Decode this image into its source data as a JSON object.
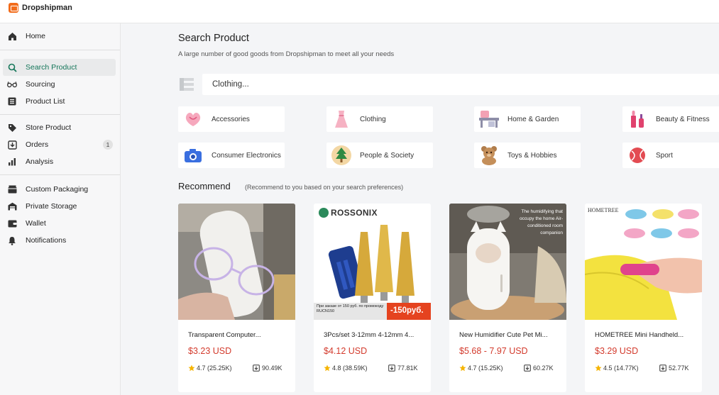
{
  "app": {
    "name": "Dropshipman"
  },
  "sidebar": {
    "groups": [
      [
        {
          "label": "Home",
          "icon": "home-icon"
        }
      ],
      [
        {
          "label": "Search Product",
          "icon": "search-icon",
          "active": true
        },
        {
          "label": "Sourcing",
          "icon": "glasses-icon"
        },
        {
          "label": "Product List",
          "icon": "list-icon"
        }
      ],
      [
        {
          "label": "Store Product",
          "icon": "tag-icon"
        },
        {
          "label": "Orders",
          "icon": "download-box-icon",
          "badge": "1"
        },
        {
          "label": "Analysis",
          "icon": "bar-chart-icon"
        }
      ],
      [
        {
          "label": "Custom Packaging",
          "icon": "package-icon"
        },
        {
          "label": "Private Storage",
          "icon": "warehouse-icon"
        },
        {
          "label": "Wallet",
          "icon": "wallet-icon"
        },
        {
          "label": "Notifications",
          "icon": "bell-icon"
        }
      ]
    ]
  },
  "main": {
    "title": "Search Product",
    "subtitle": "A large number of good goods from Dropshipman to meet all your needs",
    "search": {
      "value": "Clothing..."
    },
    "categories": [
      {
        "label": "Accessories",
        "icon": "accessories-icon"
      },
      {
        "label": "Clothing",
        "icon": "dress-icon"
      },
      {
        "label": "Home & Garden",
        "icon": "furniture-icon"
      },
      {
        "label": "Beauty & Fitness",
        "icon": "cosmetics-icon"
      },
      {
        "label": "Consumer Electronics",
        "icon": "camera-icon"
      },
      {
        "label": "People & Society",
        "icon": "tree-icon"
      },
      {
        "label": "Toys & Hobbies",
        "icon": "teddy-bear-icon"
      },
      {
        "label": "Sport",
        "icon": "ball-icon"
      }
    ],
    "recommend": {
      "title": "Recommend",
      "subtitle": "(Recommend to you based on your search preferences)"
    },
    "products": [
      {
        "name": "Transparent Computer...",
        "price": "$3.23 USD",
        "rating": "4.7 (25.25K)",
        "downloads": "90.49K",
        "image": "glasses-photo"
      },
      {
        "name": "3Pcs/set 3-12mm 4-12mm 4...",
        "price": "$4.12 USD",
        "rating": "4.8 (38.59K)",
        "downloads": "77.81K",
        "image": "drill-bits-photo",
        "brand": "ROSSONIX",
        "promo_text": "При заказе от 150 руб. по промокоду RUCN150",
        "promo_badge": "-150руб."
      },
      {
        "name": "New Humidifier Cute Pet Mi...",
        "price": "$5.68 - 7.97 USD",
        "rating": "4.7 (15.25K)",
        "downloads": "60.27K",
        "image": "humidifier-photo",
        "overlay_text": "The humidifying that occupy the home Air-conditioned room companion"
      },
      {
        "name": "HOMETREE Mini Handheld...",
        "price": "$3.29 USD",
        "rating": "4.5 (14.77K)",
        "downloads": "52.77K",
        "image": "bag-sealer-photo",
        "brand": "HOMETREE"
      }
    ]
  },
  "colors": {
    "accent": "#16775a",
    "price": "#d33a2c",
    "logo": "#f26c1b",
    "star": "#f5b400"
  }
}
